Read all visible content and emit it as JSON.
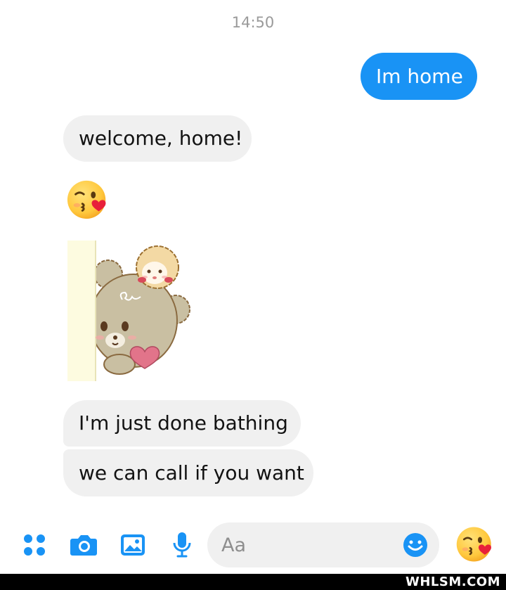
{
  "conversation": {
    "timestamp": "14:50",
    "messages": [
      {
        "direction": "outgoing",
        "type": "text",
        "text": "Im home"
      },
      {
        "direction": "incoming",
        "type": "text",
        "text": "welcome, home!"
      },
      {
        "direction": "incoming",
        "type": "emoji",
        "emoji": "face-blowing-kiss"
      },
      {
        "direction": "incoming",
        "type": "sticker",
        "sticker": "bear-peeking-with-heart"
      },
      {
        "direction": "incoming",
        "type": "text",
        "text": "I'm just done bathing"
      },
      {
        "direction": "incoming",
        "type": "text",
        "text": "we can call if you want"
      }
    ]
  },
  "composer": {
    "tools": [
      "more-apps-icon",
      "camera-icon",
      "gallery-icon",
      "microphone-icon"
    ],
    "placeholder": "Aa",
    "emoji_button": "smiley-icon",
    "quick_reaction": "face-blowing-kiss"
  },
  "watermark": "WHLSM.COM",
  "colors": {
    "accent": "#1993f5",
    "incoming_bubble": "#f0f0f0",
    "timestamp": "#9a9a9a"
  }
}
